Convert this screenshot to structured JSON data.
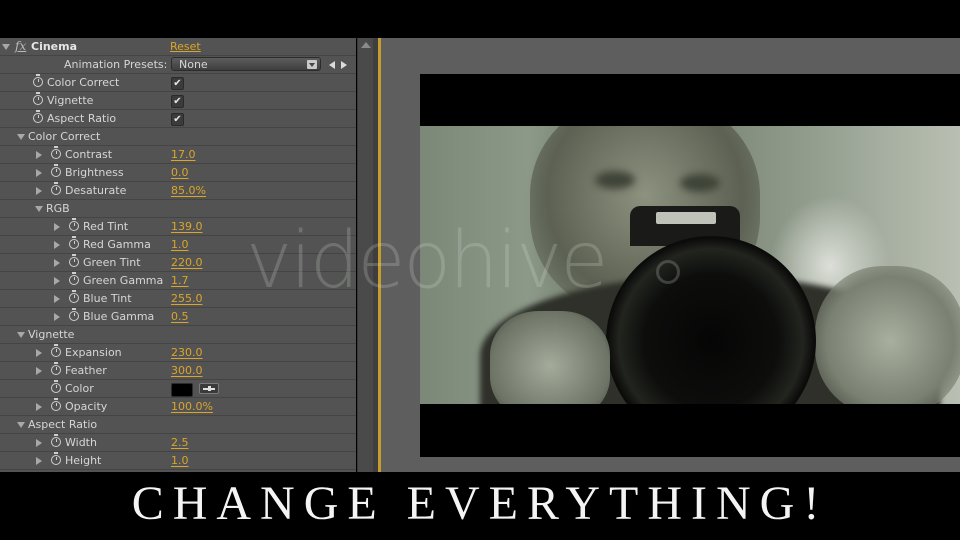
{
  "effect_panel": {
    "effect_name": "Cinema",
    "fx_label": "fx",
    "reset_label": "Reset",
    "presets_label": "Animation Presets:",
    "presets_value": "None",
    "toggles": [
      {
        "label": "Color Correct",
        "checked": true,
        "check_glyph": "✔"
      },
      {
        "label": "Vignette",
        "checked": true,
        "check_glyph": "✔"
      },
      {
        "label": "Aspect Ratio",
        "checked": true,
        "check_glyph": "✔"
      }
    ],
    "groups": {
      "color_correct": {
        "label": "Color Correct",
        "contrast": {
          "label": "Contrast",
          "value": "17.0"
        },
        "brightness": {
          "label": "Brightness",
          "value": "0.0"
        },
        "desaturate": {
          "label": "Desaturate",
          "value": "85.0",
          "unit": "%"
        },
        "rgb": {
          "label": "RGB",
          "red_tint": {
            "label": "Red Tint",
            "value": "139.0"
          },
          "red_gamma": {
            "label": "Red Gamma",
            "value": "1.0"
          },
          "green_tint": {
            "label": "Green Tint",
            "value": "220.0"
          },
          "green_gamma": {
            "label": "Green Gamma",
            "value": "1.7"
          },
          "blue_tint": {
            "label": "Blue Tint",
            "value": "255.0"
          },
          "blue_gamma": {
            "label": "Blue Gamma",
            "value": "0.5"
          }
        }
      },
      "vignette": {
        "label": "Vignette",
        "expansion": {
          "label": "Expansion",
          "value": "230.0"
        },
        "feather": {
          "label": "Feather",
          "value": "300.0"
        },
        "color": {
          "label": "Color",
          "swatch": "#000000"
        },
        "opacity": {
          "label": "Opacity",
          "value": "100.0",
          "unit": "%"
        }
      },
      "aspect_ratio": {
        "label": "Aspect Ratio",
        "width": {
          "label": "Width",
          "value": "2.5"
        },
        "height": {
          "label": "Height",
          "value": "1.0"
        }
      }
    }
  },
  "preview": {
    "watermark": "videohive"
  },
  "caption": "CHANGE EVERYTHING!",
  "colors": {
    "panel_bg": "#535353",
    "value_accent": "#d9a62b",
    "timeline_marker": "#c79c2c",
    "viewer_bg": "#5e5e5e"
  }
}
